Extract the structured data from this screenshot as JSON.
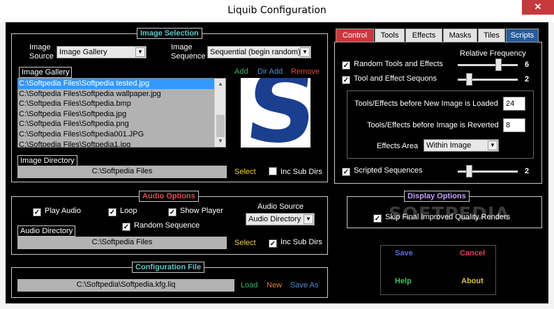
{
  "window": {
    "title": "Liquib Configuration",
    "close_glyph": "✕"
  },
  "image_selection": {
    "legend": "Image Selection",
    "source_label": "Image\nSource",
    "source_value": "Image Gallery",
    "sequence_label": "Image\nSequence",
    "sequence_value": "Sequential (begin random)",
    "gallery_label": "Image Gallery",
    "actions": {
      "add": "Add",
      "dir_add": "Dir Add",
      "remove": "Remove"
    },
    "files": [
      "C:\\Softpedia Files\\Softpedia tested.jpg",
      "C:\\Softpedia Files\\Softpedia wallpaper.jpg",
      "C:\\Softpedia Files\\Softpedia.bmp",
      "C:\\Softpedia Files\\Softpedia.jpg",
      "C:\\Softpedia Files\\Softpedia.png",
      "C:\\Softpedia Files\\Softpedia001.JPG",
      "C:\\Softpedia Files\\Softpedia1.jpg"
    ],
    "selected_index": 0,
    "preview_letter": "S",
    "directory_label": "Image Directory",
    "directory_value": "C:\\Softpedia Files",
    "select": "Select",
    "inc_sub_dirs": "Inc Sub Dirs",
    "inc_sub_dirs_checked": false
  },
  "audio": {
    "legend": "Audio Options",
    "play_audio": "Play Audio",
    "loop": "Loop",
    "show_player": "Show Player",
    "random_sequence": "Random Sequence",
    "source_label": "Audio Source",
    "source_value": "Audio Directory",
    "directory_label": "Audio Directory",
    "directory_value": "C:\\Softpedia Files",
    "select": "Select",
    "inc_sub_dirs": "Inc Sub Dirs"
  },
  "config_file": {
    "legend": "Configuration File",
    "path": "C:\\Softpedia\\Softpedia.kfg.liq",
    "load": "Load",
    "new": "New",
    "save_as": "Save As"
  },
  "tabs": [
    "Control",
    "Tools",
    "Effects",
    "Masks",
    "Tiles",
    "Scripts"
  ],
  "control": {
    "relative_frequency": "Relative Frequency",
    "random_tools": "Random Tools and Effects",
    "random_tools_value": "6",
    "random_tools_level": 0.7,
    "tool_sequences": "Tool and Effect Sequons",
    "tool_sequences_value": "2",
    "tool_sequences_level": 0.15,
    "before_new_label": "Tools/Effects before New Image is Loaded",
    "before_new_value": "24",
    "before_revert_label": "Tools/Effects before Image is Reverted",
    "before_revert_value": "8",
    "effects_area_label": "Effects Area",
    "effects_area_value": "Within Image",
    "scripted_sequences": "Scripted Sequences",
    "scripted_value": "2",
    "scripted_level": 0.15
  },
  "display": {
    "legend": "Display Options",
    "skip_final": "Skip Final Improved Quality Renders",
    "watermark": "SOFTPEDIA"
  },
  "buttons": {
    "save": "Save",
    "cancel": "Cancel",
    "help": "Help",
    "about": "About"
  },
  "colors": {
    "legend_cyan": "#5bc8c8",
    "legend_red": "#e05050",
    "legend_violet": "#c8a0ff",
    "add_green": "#3ab26a",
    "dir_add_blue": "#4d8fd6",
    "remove_red": "#e0453a",
    "select_yellow": "#f0d040",
    "new_orange": "#e08030",
    "save_blue": "#5b6cf0",
    "cancel_red": "#e0405a",
    "help_green": "#40c060",
    "about_yellow": "#e0c040"
  }
}
